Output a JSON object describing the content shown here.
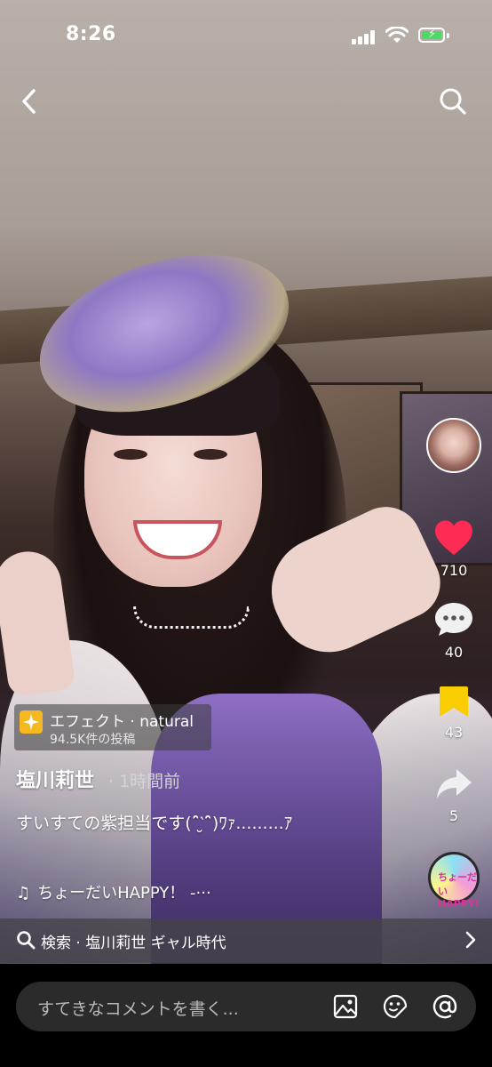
{
  "status_bar": {
    "time": "8:26"
  },
  "nav": {
    "back_icon": "chevron-left-icon",
    "search_icon": "search-icon"
  },
  "sidebar": {
    "likes": "710",
    "comments": "40",
    "saves": "43",
    "shares": "5",
    "like_color": "#fe2c55",
    "save_color": "#facd00"
  },
  "effect": {
    "title": "エフェクト · natural",
    "posts": "94.5K件の投稿"
  },
  "post": {
    "username": "塩川莉世",
    "time": "· 1時間前",
    "caption": "すいすての紫担当です(ˆ̑‵̮ˆ̑)ﾜｧ.........ｱ",
    "music": "ちょーだいHAPPY！ -···"
  },
  "music_disc_label": "ちょーだいHAPPY!",
  "search": {
    "label": "検索 · 塩川莉世 ギャル時代"
  },
  "comment": {
    "placeholder": "すてきなコメントを書く..."
  }
}
